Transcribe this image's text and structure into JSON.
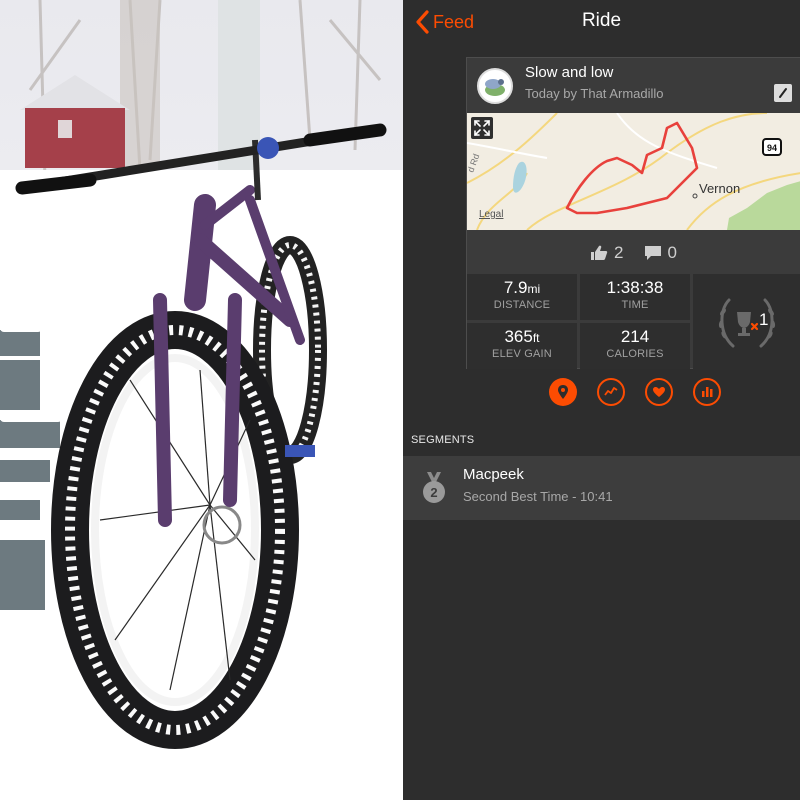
{
  "nav": {
    "back_label": "Feed",
    "title": "Ride"
  },
  "activity": {
    "name": "Slow and low",
    "subtitle": "Today by That  Armadillo"
  },
  "map": {
    "labels": [
      "Vernon",
      "Legal",
      "94",
      "d Rd"
    ]
  },
  "social": {
    "kudos_count": "2",
    "comments_count": "0"
  },
  "stats": {
    "distance": {
      "value": "7.9",
      "unit": "mi",
      "label": "DISTANCE"
    },
    "time": {
      "value": "1:38:38",
      "label": "TIME"
    },
    "elevation": {
      "value": "365",
      "unit": "ft",
      "label": "ELEV GAIN"
    },
    "calories": {
      "value": "214",
      "label": "CALORIES"
    },
    "achievements_count": "1"
  },
  "actions": [
    {
      "icon": "map-pin-icon",
      "active": true
    },
    {
      "icon": "segments-icon",
      "active": false
    },
    {
      "icon": "heart-icon",
      "active": false
    },
    {
      "icon": "analysis-icon",
      "active": false
    }
  ],
  "segments": {
    "header": "SEGMENTS",
    "items": [
      {
        "medal_rank": "2",
        "name": "Macpeek",
        "detail": "Second Best Time - 10:41"
      }
    ]
  },
  "colors": {
    "accent": "#fc4c02",
    "background": "#2d2d2d",
    "card": "#3b3b3b",
    "route": "#e8413c"
  }
}
